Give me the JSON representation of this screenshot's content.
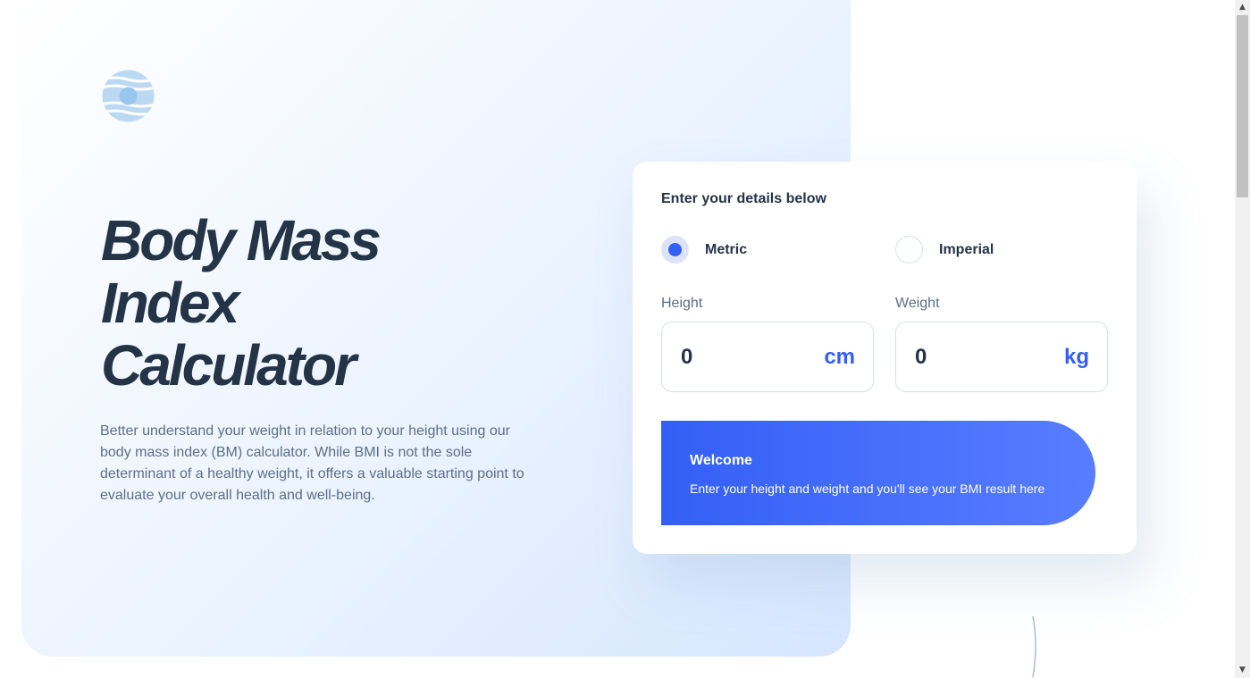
{
  "hero": {
    "title_lines": [
      "Body Mass",
      "Index",
      "Calculator"
    ],
    "description": "Better understand your weight in relation to your height using our body mass index (BM) calculator. While BMI is not the sole determinant of a healthy weight, it offers a valuable starting point to evaluate your overall health and well-being."
  },
  "calculator": {
    "heading": "Enter your details below",
    "units": {
      "metric_label": "Metric",
      "imperial_label": "Imperial",
      "selected": "metric"
    },
    "height": {
      "label": "Height",
      "value": "0",
      "unit": "cm"
    },
    "weight": {
      "label": "Weight",
      "value": "0",
      "unit": "kg"
    },
    "result": {
      "title": "Welcome",
      "message": "Enter your height and weight and you'll see your BMI result here"
    }
  },
  "colors": {
    "accent": "#345ff6",
    "heading": "#253347",
    "body_text": "#5e6e85",
    "border": "#d8e2e7"
  },
  "icons": {
    "logo": "logo-icon",
    "scroll_up": "chevron-up-icon",
    "scroll_down": "chevron-down-icon"
  }
}
